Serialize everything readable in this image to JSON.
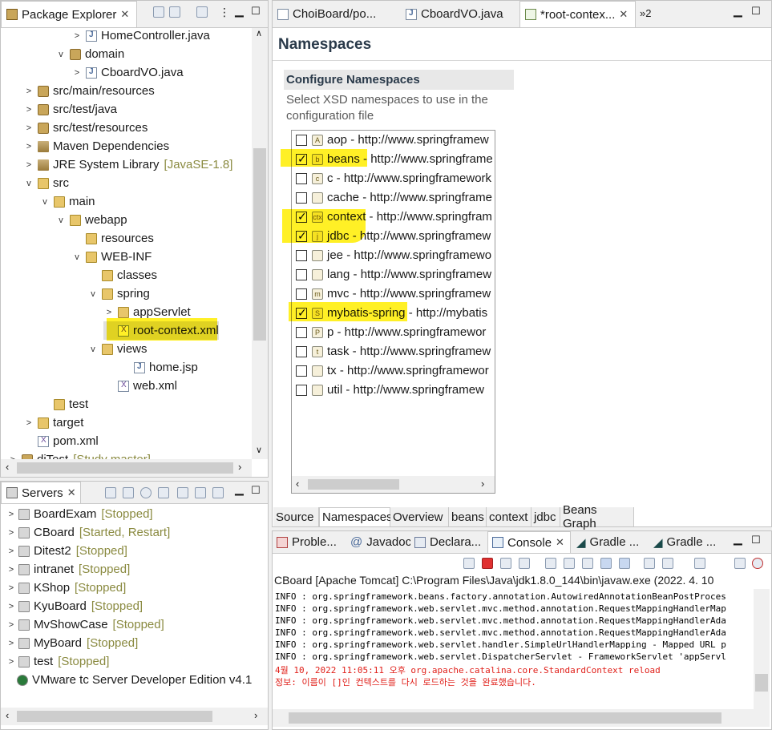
{
  "package_explorer": {
    "tab_label": "Package Explorer",
    "tree": [
      {
        "label": "HomeController.java",
        "icon": "java-file-icon",
        "twisty": ">",
        "indent": 5
      },
      {
        "label": "domain",
        "icon": "package-icon",
        "twisty": "v",
        "indent": 4
      },
      {
        "label": "CboardVO.java",
        "icon": "java-file-icon",
        "twisty": ">",
        "indent": 5
      },
      {
        "label": "src/main/resources",
        "icon": "source-folder-icon",
        "twisty": ">",
        "indent": 2
      },
      {
        "label": "src/test/java",
        "icon": "source-folder-icon",
        "twisty": ">",
        "indent": 2
      },
      {
        "label": "src/test/resources",
        "icon": "source-folder-icon",
        "twisty": ">",
        "indent": 2
      },
      {
        "label": "Maven Dependencies",
        "icon": "library-icon",
        "twisty": ">",
        "indent": 2
      },
      {
        "label": "JRE System Library",
        "icon": "library-icon",
        "twisty": ">",
        "indent": 2,
        "decoration": "[JavaSE-1.8]"
      },
      {
        "label": "src",
        "icon": "folder-icon",
        "twisty": "v",
        "indent": 2
      },
      {
        "label": "main",
        "icon": "folder-icon",
        "twisty": "v",
        "indent": 3
      },
      {
        "label": "webapp",
        "icon": "folder-icon",
        "twisty": "v",
        "indent": 4
      },
      {
        "label": "resources",
        "icon": "folder-icon",
        "twisty": "",
        "indent": 5
      },
      {
        "label": "WEB-INF",
        "icon": "folder-icon",
        "twisty": "v",
        "indent": 5
      },
      {
        "label": "classes",
        "icon": "folder-icon",
        "twisty": "",
        "indent": 6
      },
      {
        "label": "spring",
        "icon": "folder-icon",
        "twisty": "v",
        "indent": 6
      },
      {
        "label": "appServlet",
        "icon": "folder-icon",
        "twisty": ">",
        "indent": 7
      },
      {
        "label": "root-context.xml",
        "icon": "spring-xml-icon",
        "twisty": "",
        "indent": 7,
        "selected": true
      },
      {
        "label": "views",
        "icon": "folder-icon",
        "twisty": "v",
        "indent": 6
      },
      {
        "label": "home.jsp",
        "icon": "jsp-file-icon",
        "twisty": "",
        "indent": 8
      },
      {
        "label": "web.xml",
        "icon": "xml-file-icon",
        "twisty": "",
        "indent": 7
      },
      {
        "label": "test",
        "icon": "folder-icon",
        "twisty": "",
        "indent": 3
      },
      {
        "label": "target",
        "icon": "folder-icon",
        "twisty": ">",
        "indent": 2
      },
      {
        "label": "pom.xml",
        "icon": "maven-file-icon",
        "twisty": "",
        "indent": 2
      },
      {
        "label": "diTest",
        "icon": "maven-project-icon",
        "twisty": ">",
        "indent": 1,
        "decoration": "[Study master]"
      }
    ]
  },
  "servers": {
    "tab_label": "Servers",
    "items": [
      {
        "name": "BoardExam",
        "status": "[Stopped]"
      },
      {
        "name": "CBoard",
        "status": "[Started, Restart]"
      },
      {
        "name": "Ditest2",
        "status": "[Stopped]"
      },
      {
        "name": "intranet",
        "status": "[Stopped]"
      },
      {
        "name": "KShop",
        "status": "[Stopped]"
      },
      {
        "name": "KyuBoard",
        "status": "[Stopped]"
      },
      {
        "name": "MvShowCase",
        "status": "[Stopped]"
      },
      {
        "name": "MyBoard",
        "status": "[Stopped]"
      },
      {
        "name": "test",
        "status": "[Stopped]"
      },
      {
        "name": "VMware tc Server Developer Edition v4.1",
        "status": ""
      }
    ]
  },
  "editor": {
    "tabs": [
      "ChoiBoard/po...",
      "CboardVO.java",
      "*root-contex..."
    ],
    "overflow": "»2",
    "title": "Namespaces",
    "section_title": "Configure Namespaces",
    "description": "Select XSD namespaces to use in the configuration file",
    "namespaces": [
      {
        "name": "aop",
        "uri": " - http://www.springframew",
        "checked": false,
        "icon": "A"
      },
      {
        "name": "beans",
        "uri": " - http://www.springframe",
        "checked": true,
        "icon": "b"
      },
      {
        "name": "c",
        "uri": " - http://www.springframework",
        "checked": false,
        "icon": "c"
      },
      {
        "name": "cache",
        "uri": " - http://www.springframe",
        "checked": false,
        "icon": ""
      },
      {
        "name": "context",
        "uri": " - http://www.springfram",
        "checked": true,
        "icon": "ctx"
      },
      {
        "name": "jdbc",
        "uri": " - http://www.springframew",
        "checked": true,
        "icon": "j"
      },
      {
        "name": "jee",
        "uri": " - http://www.springframewo",
        "checked": false,
        "icon": ""
      },
      {
        "name": "lang",
        "uri": " - http://www.springframew",
        "checked": false,
        "icon": ""
      },
      {
        "name": "mvc",
        "uri": " - http://www.springframew",
        "checked": false,
        "icon": "m"
      },
      {
        "name": "mybatis-spring",
        "uri": " - http://mybatis",
        "checked": true,
        "icon": "S"
      },
      {
        "name": "p",
        "uri": " - http://www.springframewor",
        "checked": false,
        "icon": "P"
      },
      {
        "name": "task",
        "uri": " - http://www.springframew",
        "checked": false,
        "icon": "t"
      },
      {
        "name": "tx",
        "uri": " - http://www.springframewor",
        "checked": false,
        "icon": ""
      },
      {
        "name": "util",
        "uri": " - http://www.springframew",
        "checked": false,
        "icon": ""
      }
    ],
    "bottom_tabs": [
      "Source",
      "Namespaces",
      "Overview",
      "beans",
      "context",
      "jdbc",
      "Beans Graph"
    ],
    "active_bottom_tab": 1
  },
  "console": {
    "tabs": [
      "Proble...",
      "Javadoc",
      "Declara...",
      "Console",
      "Gradle ...",
      "Gradle ..."
    ],
    "active_tab": 3,
    "process_label": "CBoard [Apache Tomcat] C:\\Program Files\\Java\\jdk1.8.0_144\\bin\\javaw.exe  (2022. 4. 10",
    "lines": [
      {
        "text": "INFO : org.springframework.beans.factory.annotation.AutowiredAnnotationBeanPostProces",
        "color": "#000000"
      },
      {
        "text": "INFO : org.springframework.web.servlet.mvc.method.annotation.RequestMappingHandlerMap",
        "color": "#000000"
      },
      {
        "text": "INFO : org.springframework.web.servlet.mvc.method.annotation.RequestMappingHandlerAda",
        "color": "#000000"
      },
      {
        "text": "INFO : org.springframework.web.servlet.mvc.method.annotation.RequestMappingHandlerAda",
        "color": "#000000"
      },
      {
        "text": "INFO : org.springframework.web.servlet.handler.SimpleUrlHandlerMapping - Mapped URL p",
        "color": "#000000"
      },
      {
        "text": "INFO : org.springframework.web.servlet.DispatcherServlet - FrameworkServlet 'appServl",
        "color": "#000000"
      },
      {
        "text": "4월 10, 2022 11:05:11 오후 org.apache.catalina.core.StandardContext reload",
        "color": "#e0201a"
      },
      {
        "text": "정보: 이름이 []인 컨텍스트를 다시 로드하는 것을 완료했습니다.",
        "color": "#e0201a"
      }
    ]
  },
  "colors": {
    "highlight": "#ffee00",
    "stopped_status": "#8a8a40",
    "console_error": "#e0201a"
  }
}
